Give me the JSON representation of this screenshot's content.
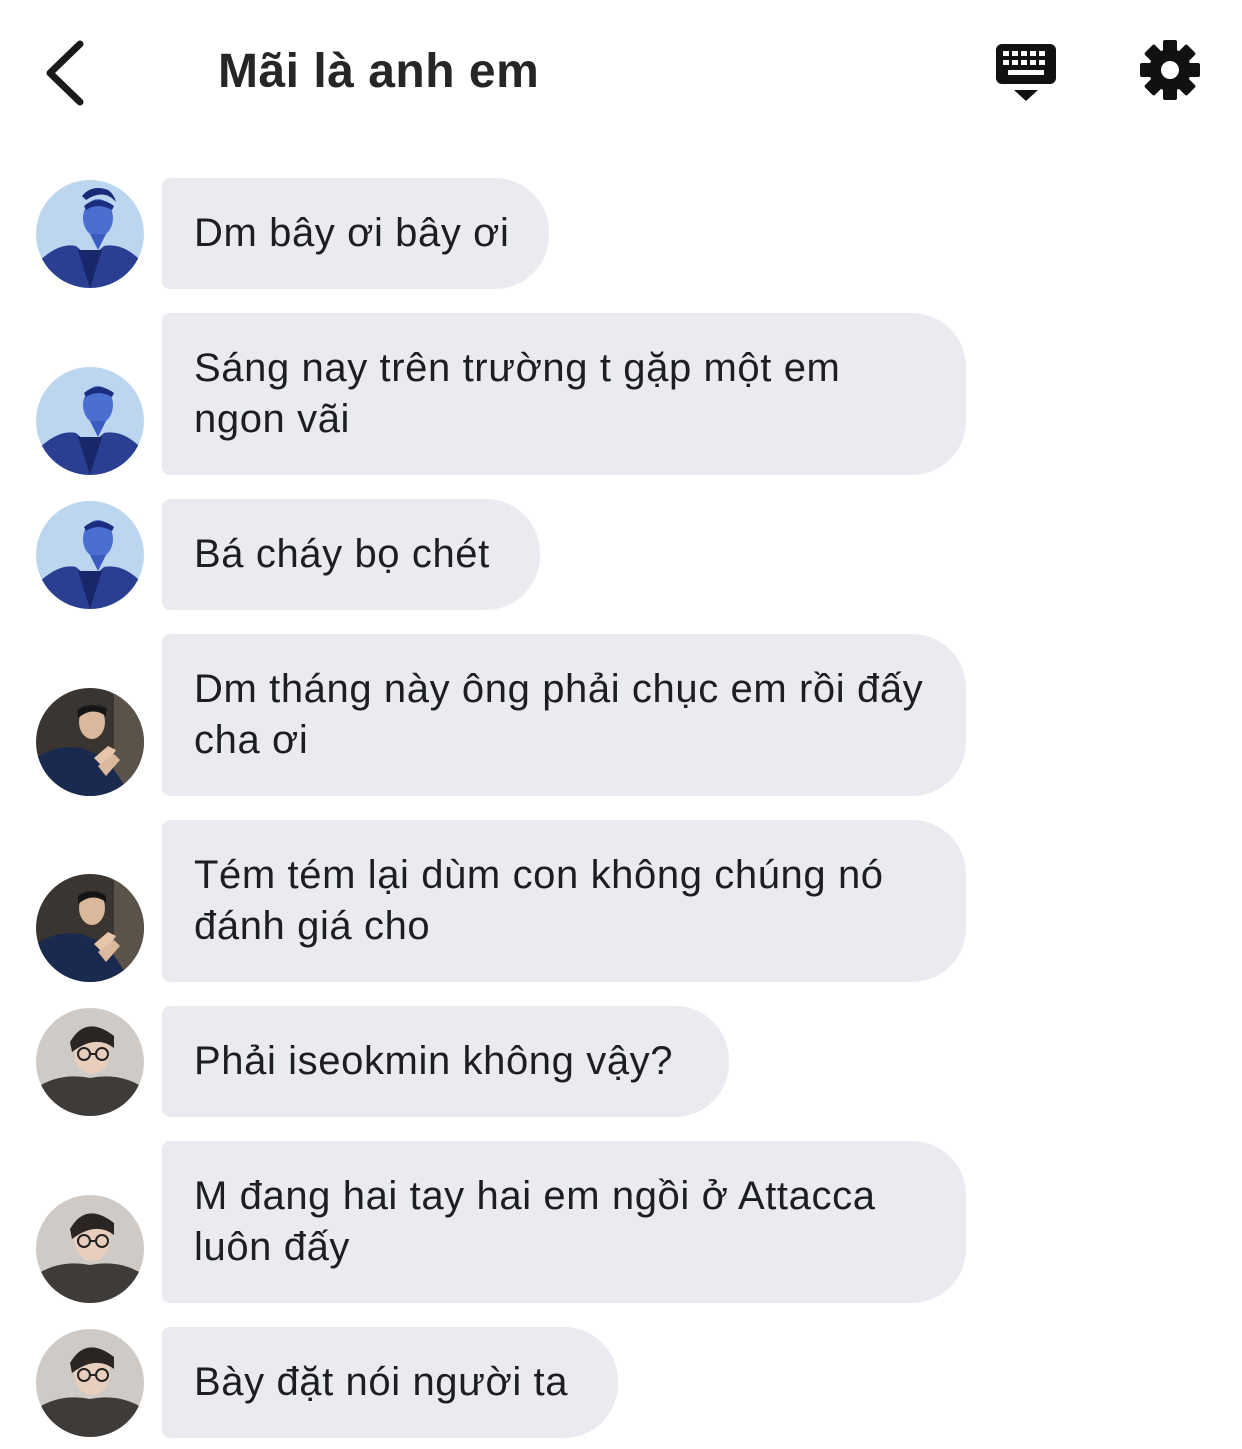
{
  "header": {
    "title": "Mãi là anh em",
    "back_icon": "chevron-left-icon",
    "keyboard_icon": "keyboard-icon",
    "settings_icon": "gear-icon"
  },
  "colors": {
    "bubble": "#e9ebf0",
    "text": "#1c1e21",
    "title": "#262626"
  },
  "messages": [
    {
      "sender": "avatar-blue",
      "text": "Dm bây ơi bây ơi"
    },
    {
      "sender": "avatar-blue",
      "text": "Sáng nay trên trường t gặp một em ngon vãi"
    },
    {
      "sender": "avatar-blue",
      "text": "Bá cháy bọ chét"
    },
    {
      "sender": "avatar-dark",
      "text": "Dm tháng này ông phải chục em rồi đấy cha ơi"
    },
    {
      "sender": "avatar-dark",
      "text": "Tém tém lại dùm con không chúng nó đánh giá cho"
    },
    {
      "sender": "avatar-glasses",
      "text": "Phải iseokmin không vậy?"
    },
    {
      "sender": "avatar-glasses",
      "text": "M đang hai tay hai em ngồi ở Attacca luôn đấy"
    },
    {
      "sender": "avatar-glasses",
      "text": "Bày đặt nói người ta"
    }
  ]
}
